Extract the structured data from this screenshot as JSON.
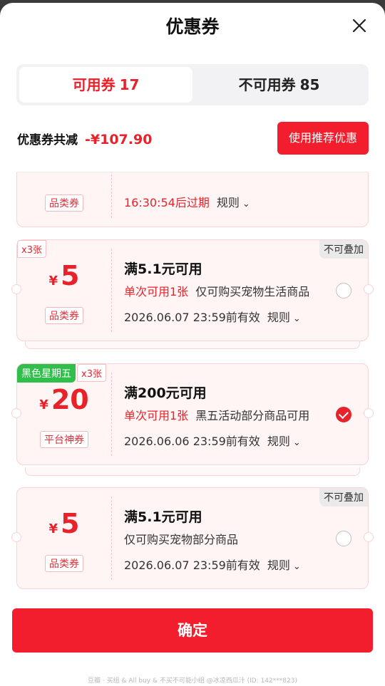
{
  "header": {
    "title": "优惠券"
  },
  "tabs": [
    {
      "label": "可用券",
      "count": "17"
    },
    {
      "label": "不可用券",
      "count": "85"
    }
  ],
  "summary": {
    "label": "优惠券共减",
    "amount": "-¥107.90",
    "recommend_button": "使用推荐优惠"
  },
  "coupons": [
    {
      "type": "品类券",
      "countdown": "16:30:54后过期",
      "rule": "规则"
    },
    {
      "qty_tag": "x3张",
      "stack_tag": "不可叠加",
      "currency": "¥",
      "amount": "5",
      "type": "品类券",
      "condition": "满5.1元可用",
      "limit": "单次可用1张",
      "scope": "仅可购买宠物生活商品",
      "expiry": "2026.06.07 23:59前有效",
      "rule": "规则",
      "selected": false
    },
    {
      "promo_tag": "黑色星期五",
      "qty_tag": "x3张",
      "currency": "¥",
      "amount": "20",
      "type": "平台神券",
      "condition": "满200元可用",
      "limit": "单次可用1张",
      "scope": "黑五活动部分商品可用",
      "expiry": "2026.06.06 23:59前有效",
      "rule": "规则",
      "selected": true
    },
    {
      "stack_tag": "不可叠加",
      "currency": "¥",
      "amount": "5",
      "type": "品类券",
      "condition": "满5.1元可用",
      "scope": "仅可购买宠物部分商品",
      "expiry": "2026.06.07 23:59前有效",
      "rule": "规则",
      "selected": false
    }
  ],
  "confirm_button": "确定",
  "footer_text": "豆瓣 · 买组 & All buy & 不买不可能小组 @冰凉西瓜汁 (ID: 142***823)",
  "colors": {
    "accent": "#e8222a",
    "button": "#f21e2e",
    "promo_green": "#2fbf4a"
  },
  "icons": {
    "close": "close-icon",
    "chevron": "chevron-down-icon",
    "check": "check-icon"
  }
}
